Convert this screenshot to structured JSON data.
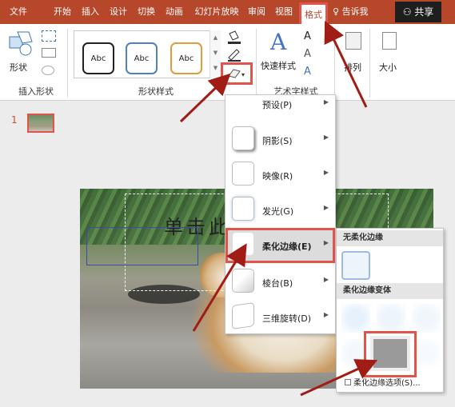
{
  "ribbon_tabs": [
    {
      "label": "文件"
    },
    {
      "label": "开始"
    },
    {
      "label": "插入"
    },
    {
      "label": "设计"
    },
    {
      "label": "切换"
    },
    {
      "label": "动画"
    },
    {
      "label": "幻灯片放映"
    },
    {
      "label": "审阅"
    },
    {
      "label": "视图"
    },
    {
      "label": "格式"
    }
  ],
  "tell_me": "告诉我",
  "share": "共享",
  "ribbon": {
    "shape_label": "形状",
    "insert_shapes_group": "插入形状",
    "shape_styles_group": "形状样式",
    "style_samples": [
      "Abc",
      "Abc",
      "Abc"
    ],
    "quick_styles": "快速样式",
    "wordart_group": "艺术字样式",
    "arrange_label": "排列",
    "size_label": "大小",
    "wordart_letter": "A"
  },
  "slide_panel": {
    "slide_number": "1"
  },
  "slide": {
    "title_fragment": "单击此    题"
  },
  "bevel_menu": {
    "items": [
      {
        "label": "预设(P)",
        "has_arrow": true
      },
      {
        "label": "阴影(S)",
        "has_arrow": true
      },
      {
        "label": "映像(R)",
        "has_arrow": true
      },
      {
        "label": "发光(G)",
        "has_arrow": true
      },
      {
        "label": "柔化边缘(E)",
        "has_arrow": true,
        "highlighted": true
      },
      {
        "label": "棱台(B)",
        "has_arrow": true
      },
      {
        "label": "三维旋转(D)",
        "has_arrow": true
      }
    ]
  },
  "soft_edges_submenu": {
    "header_none": "无柔化边缘",
    "header_variants": "柔化边缘变体",
    "footer": "柔化边缘选项(S)..."
  },
  "colors": {
    "accent": "#b7472a",
    "highlight": "#e0544a",
    "annotation_arrow": "#a01c14"
  }
}
